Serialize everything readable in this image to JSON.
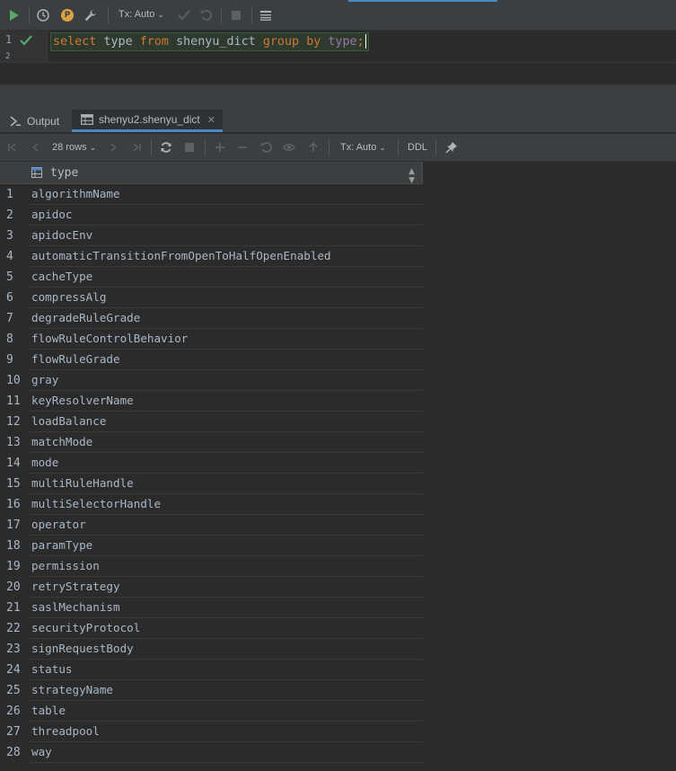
{
  "toolbar": {
    "tx_mode": "Tx: Auto",
    "p_badge": "P"
  },
  "editor": {
    "line_numbers": [
      "1",
      "2"
    ],
    "sql": {
      "kw_select": "select",
      "col": "type",
      "kw_from": "from",
      "table": "shenyu_dict",
      "kw_group": "group",
      "kw_by": "by",
      "group_col": "type",
      "end": ";"
    }
  },
  "tabs": [
    {
      "label": "Output"
    },
    {
      "label": "shenyu2.shenyu_dict"
    }
  ],
  "result_toolbar": {
    "rows_label": "28 rows",
    "tx_mode": "Tx: Auto",
    "ddl_label": "DDL"
  },
  "grid": {
    "column": "type",
    "rows": [
      {
        "n": "1",
        "v": "algorithmName"
      },
      {
        "n": "2",
        "v": "apidoc"
      },
      {
        "n": "3",
        "v": "apidocEnv"
      },
      {
        "n": "4",
        "v": "automaticTransitionFromOpenToHalfOpenEnabled"
      },
      {
        "n": "5",
        "v": "cacheType"
      },
      {
        "n": "6",
        "v": "compressAlg"
      },
      {
        "n": "7",
        "v": "degradeRuleGrade"
      },
      {
        "n": "8",
        "v": "flowRuleControlBehavior"
      },
      {
        "n": "9",
        "v": "flowRuleGrade"
      },
      {
        "n": "10",
        "v": "gray"
      },
      {
        "n": "11",
        "v": "keyResolverName"
      },
      {
        "n": "12",
        "v": "loadBalance"
      },
      {
        "n": "13",
        "v": "matchMode"
      },
      {
        "n": "14",
        "v": "mode"
      },
      {
        "n": "15",
        "v": "multiRuleHandle"
      },
      {
        "n": "16",
        "v": "multiSelectorHandle"
      },
      {
        "n": "17",
        "v": "operator"
      },
      {
        "n": "18",
        "v": "paramType"
      },
      {
        "n": "19",
        "v": "permission"
      },
      {
        "n": "20",
        "v": "retryStrategy"
      },
      {
        "n": "21",
        "v": "saslMechanism"
      },
      {
        "n": "22",
        "v": "securityProtocol"
      },
      {
        "n": "23",
        "v": "signRequestBody"
      },
      {
        "n": "24",
        "v": "status"
      },
      {
        "n": "25",
        "v": "strategyName"
      },
      {
        "n": "26",
        "v": "table"
      },
      {
        "n": "27",
        "v": "threadpool"
      },
      {
        "n": "28",
        "v": "way"
      }
    ]
  },
  "colors": {
    "background": "#2b2b2b",
    "toolbar": "#3c3f41",
    "keyword": "#cc7832",
    "identifier": "#a9b7c6",
    "function": "#9876aa",
    "run_green": "#59a869",
    "accent": "#4a88c7"
  }
}
